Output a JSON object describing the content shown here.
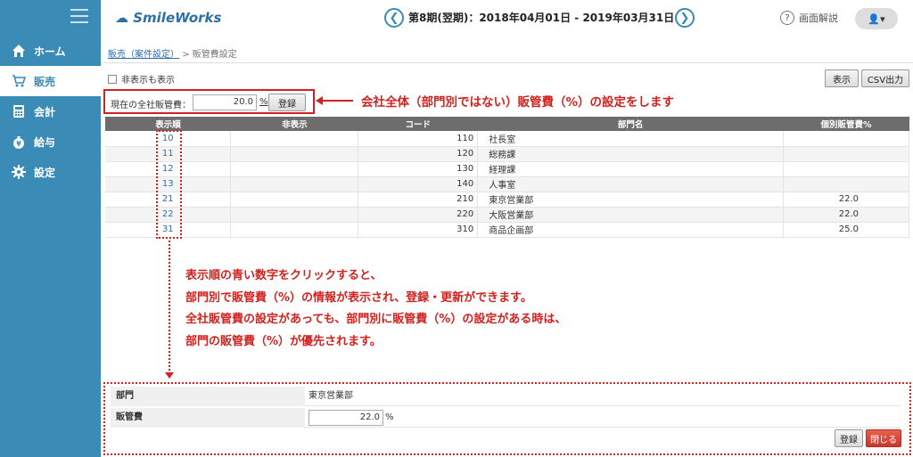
{
  "sidebar": {
    "items": [
      {
        "label": "ホーム",
        "icon": "home-icon"
      },
      {
        "label": "販売",
        "icon": "cart-icon"
      },
      {
        "label": "会計",
        "icon": "calculator-icon"
      },
      {
        "label": "給与",
        "icon": "moneybag-icon"
      },
      {
        "label": "設定",
        "icon": "gear-icon"
      }
    ],
    "active_index": 1
  },
  "header": {
    "logo": "SmileWorks",
    "period": "第8期(翌期)：2018年04月01日 - 2019年03月31日",
    "prev": "❮",
    "next": "❯",
    "help_icon": "?",
    "help_label": "画面解説",
    "user": "👤▾"
  },
  "breadcrumb": {
    "link": "販売（案件設定）",
    "separator": ">",
    "current": "販管費設定"
  },
  "filter": {
    "show_hidden_label": "非表示も表示"
  },
  "toolbar": {
    "display_label": "表示",
    "csv_label": "CSV出力"
  },
  "rate": {
    "label": "現在の全社販管費：",
    "value": "20.0",
    "unit": "%",
    "register_label": "登録"
  },
  "annotations": {
    "top": "会社全体（部門別ではない）販管費（%）の設定をします",
    "bottom": [
      "表示順の青い数字をクリックすると、",
      "部門別で販管費（%）の情報が表示され、登録・更新ができます。",
      "全社販管費の設定があっても、部門別に販管費（%）の設定がある時は、",
      "部門の販管費（%）が優先されます。"
    ]
  },
  "table": {
    "columns": [
      "表示順",
      "非表示",
      "コード",
      "部門名",
      "個別販管費%"
    ],
    "rows": [
      {
        "order": "10",
        "hidden": "",
        "code": "110",
        "name": "社長室",
        "rate": ""
      },
      {
        "order": "11",
        "hidden": "",
        "code": "120",
        "name": "総務課",
        "rate": ""
      },
      {
        "order": "12",
        "hidden": "",
        "code": "130",
        "name": "経理課",
        "rate": ""
      },
      {
        "order": "13",
        "hidden": "",
        "code": "140",
        "name": "人事室",
        "rate": ""
      },
      {
        "order": "21",
        "hidden": "",
        "code": "210",
        "name": "東京営業部",
        "rate": "22.0"
      },
      {
        "order": "22",
        "hidden": "",
        "code": "220",
        "name": "大阪営業部",
        "rate": "22.0"
      },
      {
        "order": "31",
        "hidden": "",
        "code": "310",
        "name": "商品企画部",
        "rate": "25.0"
      }
    ]
  },
  "detail": {
    "dept_label": "部門",
    "dept_value": "東京営業部",
    "rate_label": "販管費",
    "rate_value": "22.0",
    "rate_unit": "%",
    "register_label": "登録",
    "close_label": "閉じる"
  },
  "colors": {
    "sidebar": "#3a8bb5",
    "accent_red": "#d0231f",
    "link_blue": "#2a6db0"
  }
}
